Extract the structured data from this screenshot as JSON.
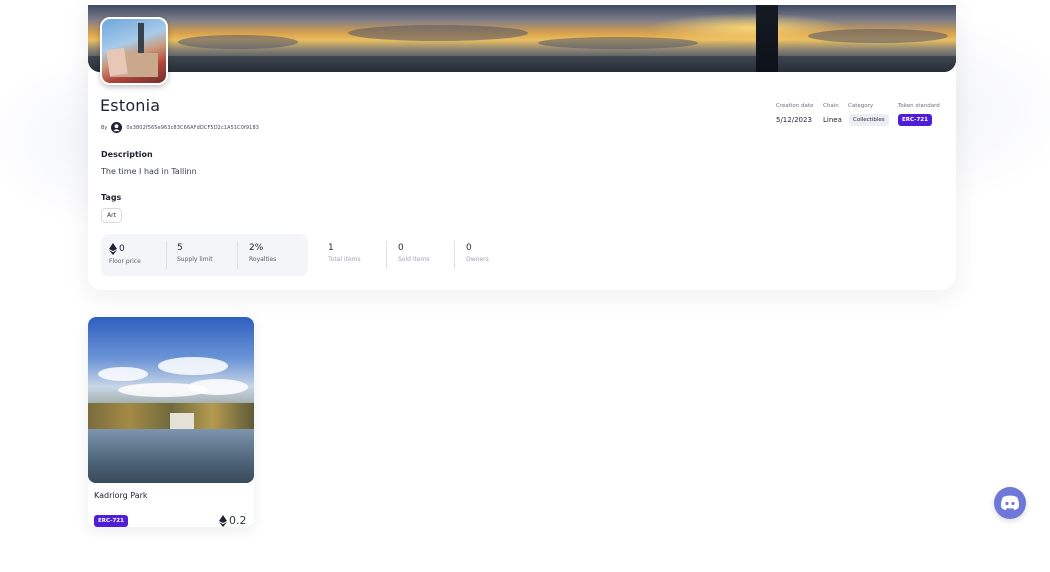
{
  "collection": {
    "title": "Estonia",
    "by_label": "By",
    "creator_address": "0x3802f565e963c83C66AFdDCF5D2c1A51C0f9183",
    "description_label": "Description",
    "description": "The time I had in Tallinn",
    "tags_label": "Tags",
    "tags": [
      "Art"
    ]
  },
  "stats": [
    {
      "value": "0",
      "label": "Floor price",
      "icon": "ethereum-icon"
    },
    {
      "value": "5",
      "label": "Supply limit"
    },
    {
      "value": "2%",
      "label": "Royalties"
    },
    {
      "value": "1",
      "label": "Total items"
    },
    {
      "value": "0",
      "label": "Sold items"
    },
    {
      "value": "0",
      "label": "Owners"
    }
  ],
  "meta": {
    "creation_date_label": "Creation date",
    "creation_date": "5/12/2023",
    "chain_label": "Chain",
    "chain": "Linea",
    "category_label": "Category",
    "category": "Collectibles",
    "token_standard_label": "Token standard",
    "token_standard": "ERC-721"
  },
  "nft": {
    "name": "Kadriorg Park",
    "standard": "ERC-721",
    "price": "0.2",
    "price_icon": "ethereum-icon"
  },
  "colors": {
    "accent": "#4f1fd7",
    "discord": "#6e78d8"
  },
  "floating": {
    "discord_icon": "discord-icon"
  }
}
